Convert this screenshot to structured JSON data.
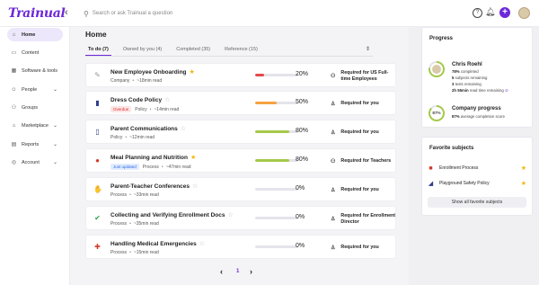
{
  "app": {
    "logo": "Trainual"
  },
  "search": {
    "placeholder": "Search or ask Trainual a question"
  },
  "sidebar": {
    "items": [
      {
        "label": "Home",
        "icon": "home-icon",
        "glyph": "⌂",
        "active": true
      },
      {
        "label": "Content",
        "icon": "content-icon",
        "glyph": "▭"
      },
      {
        "label": "Software & tools",
        "icon": "tools-icon",
        "glyph": "▦"
      },
      {
        "label": "People",
        "icon": "people-icon",
        "glyph": "☺",
        "chevron": true
      },
      {
        "label": "Groups",
        "icon": "groups-icon",
        "glyph": "⚇"
      },
      {
        "label": "Marketplace",
        "icon": "marketplace-icon",
        "glyph": "⌂",
        "chevron": true
      },
      {
        "label": "Reports",
        "icon": "reports-icon",
        "glyph": "▤",
        "chevron": true
      },
      {
        "label": "Account",
        "icon": "account-icon",
        "glyph": "◎",
        "chevron": true
      }
    ]
  },
  "page": {
    "title": "Home"
  },
  "tabs": [
    {
      "label": "To do (7)",
      "active": true
    },
    {
      "label": "Owned by you (4)"
    },
    {
      "label": "Completed (35)"
    },
    {
      "label": "Reference (15)"
    }
  ],
  "rows": [
    {
      "title": "New Employee Onboarding",
      "starred": true,
      "badge": "",
      "type": "Company",
      "time": "~18min read",
      "progress": 20,
      "pct": "20%",
      "color": "#e54848",
      "req": "Required for US Full-time Employees",
      "reqIcon": "group-icon",
      "icon": "onboarding-icon",
      "glyph": "✎",
      "iconColor": "#999"
    },
    {
      "title": "Dress Code Policy",
      "starred": false,
      "badge": "Overdue",
      "badgeColor": "red",
      "type": "Policy",
      "time": "~14min read",
      "progress": 50,
      "pct": "50%",
      "color": "#f4a340",
      "req": "Required for you",
      "reqIcon": "person-icon",
      "icon": "pants-icon",
      "glyph": "▮",
      "iconColor": "#2d3a8c"
    },
    {
      "title": "Parent Communications",
      "starred": false,
      "badge": "",
      "type": "Policy",
      "time": "~12min read",
      "progress": 80,
      "pct": "80%",
      "color": "#a4c84a",
      "req": "Required for you",
      "reqIcon": "person-icon",
      "icon": "phone-icon",
      "glyph": "▯",
      "iconColor": "#2d3a8c"
    },
    {
      "title": "Meal Planning and Nutrition",
      "starred": true,
      "badge": "Just updated",
      "badgeColor": "blue",
      "type": "Process",
      "time": "~47min read",
      "progress": 80,
      "pct": "80%",
      "color": "#a4c84a",
      "req": "Required for Teachers",
      "reqIcon": "group-icon",
      "icon": "apple-icon",
      "glyph": "●",
      "iconColor": "#d23a2a"
    },
    {
      "title": "Parent-Teacher Conferences",
      "starred": false,
      "badge": "",
      "type": "Process",
      "time": "~33min read",
      "progress": 0,
      "pct": "0%",
      "color": "#a4c84a",
      "req": "Required for you",
      "reqIcon": "person-icon",
      "icon": "handshake-icon",
      "glyph": "✋",
      "iconColor": "#f2b630"
    },
    {
      "title": "Collecting and Verifying Enrollment Docs",
      "starred": false,
      "badge": "",
      "type": "Process",
      "time": "~35min read",
      "progress": 0,
      "pct": "0%",
      "color": "#a4c84a",
      "req": "Required for Enrollment Director",
      "reqIcon": "person-icon",
      "icon": "check-icon",
      "glyph": "✔",
      "iconColor": "#2aa84a"
    },
    {
      "title": "Handling Medical Emergencies",
      "starred": false,
      "badge": "",
      "type": "Process",
      "time": "~15min read",
      "progress": 0,
      "pct": "0%",
      "color": "#a4c84a",
      "req": "Required for you",
      "reqIcon": "person-icon",
      "icon": "first-aid-icon",
      "glyph": "✚",
      "iconColor": "#d23a2a"
    }
  ],
  "pagination": {
    "page": "1"
  },
  "progress_card": {
    "title": "Progress",
    "name": "Chris Roehl",
    "completed": "78%",
    "completed_label": "completed",
    "subjects": "5",
    "subjects_label": "subjects remaining",
    "tests": "3",
    "tests_label": "tests remaining",
    "read_time": "2h 55min",
    "read_time_label": "read time remaining",
    "company_title": "Company progress",
    "company_pct": "87%",
    "company_avg": "87%",
    "company_avg_label": "average completion score",
    "user_progress": 78,
    "company_progress": 87
  },
  "favorites": {
    "title": "Favorite subjects",
    "items": [
      {
        "label": "Enrollment Process",
        "icon": "folder-icon",
        "glyph": "■",
        "color": "#d23a2a"
      },
      {
        "label": "Playground Safety Policy",
        "icon": "slide-icon",
        "glyph": "◢",
        "color": "#2d3a8c"
      }
    ],
    "show_all": "Show all favorite subjects"
  },
  "colors": {
    "accent": "#6d28d9",
    "ring": "#a4c84a"
  }
}
